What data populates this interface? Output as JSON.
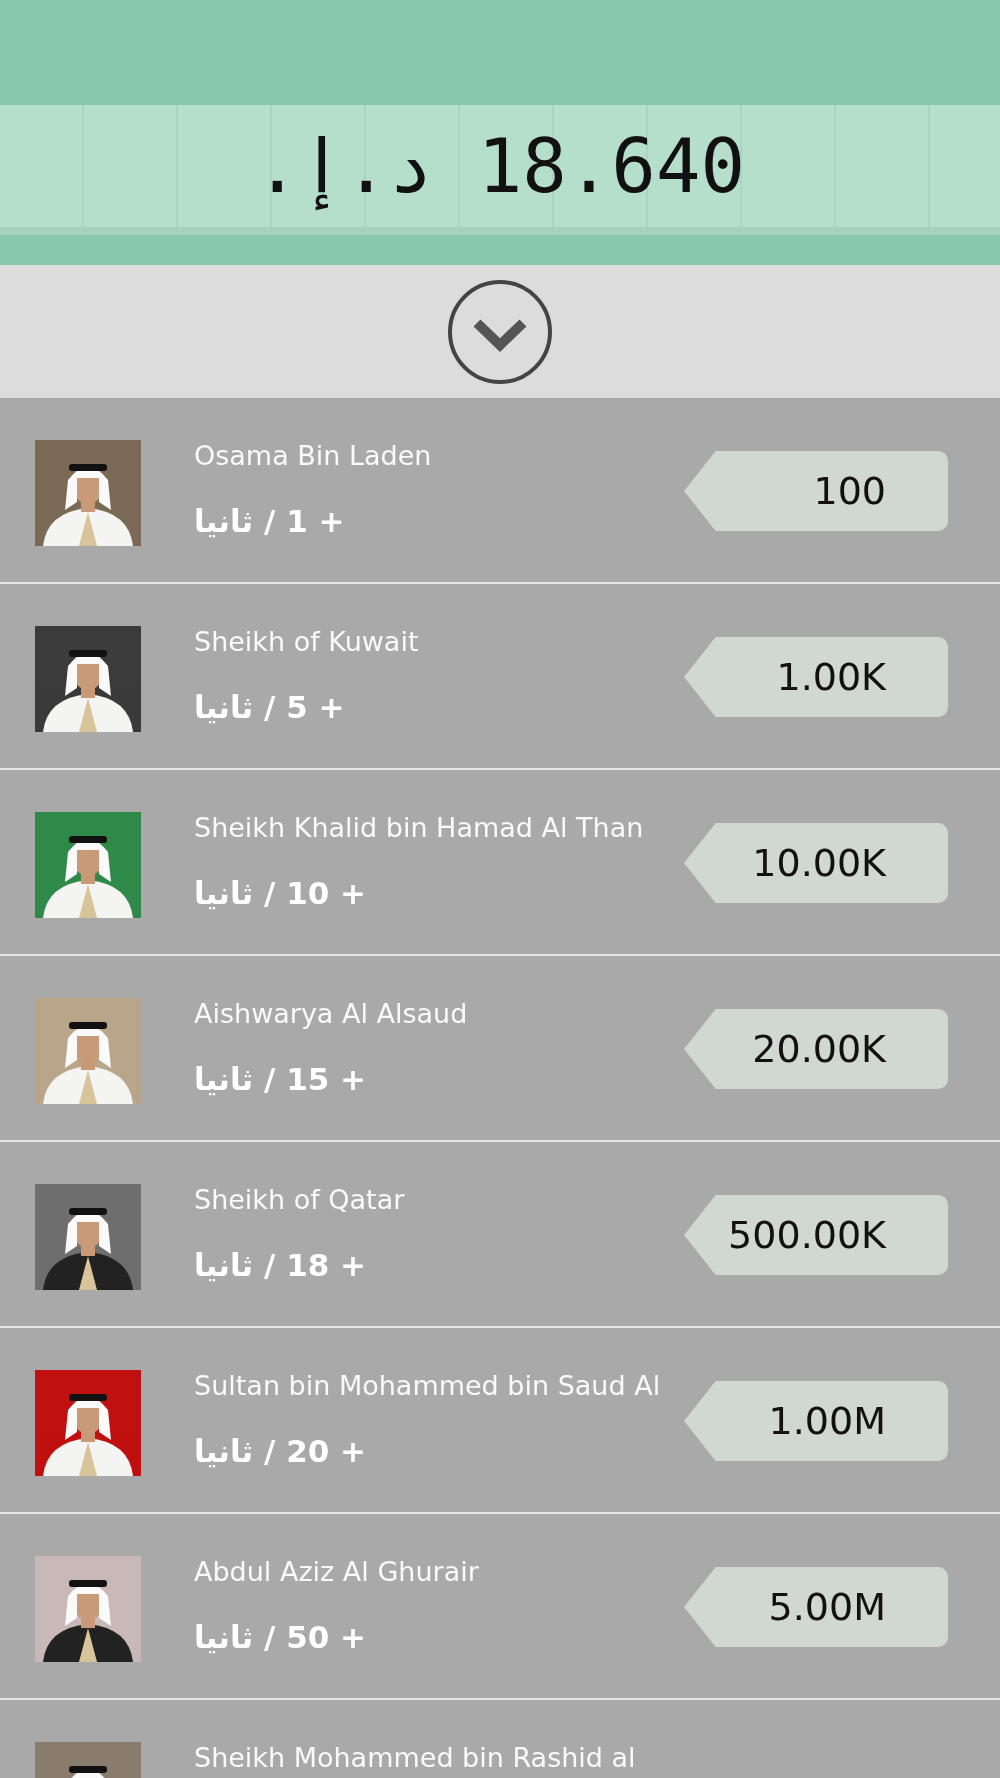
{
  "balance": "18.640 د.إ.",
  "toggle": {
    "expanded": false
  },
  "items": [
    {
      "name": "Osama Bin Laden",
      "rate": "+ 1 / ثانيا",
      "price": "100"
    },
    {
      "name": "Sheikh of Kuwait",
      "rate": "+ 5 / ثانيا",
      "price": "1.00K"
    },
    {
      "name": "Sheikh Khalid bin Hamad Al Than",
      "rate": "+ 10 / ثانيا",
      "price": "10.00K"
    },
    {
      "name": "Aishwarya Al Alsaud",
      "rate": "+ 15 / ثانيا",
      "price": "20.00K"
    },
    {
      "name": "Sheikh of Qatar",
      "rate": "+ 18 / ثانيا",
      "price": "500.00K"
    },
    {
      "name": "Sultan bin Mohammed bin Saud Al",
      "rate": "+ 20 / ثانيا",
      "price": "1.00M"
    },
    {
      "name": "Abdul Aziz Al Ghurair",
      "rate": "+ 50 / ثانيا",
      "price": "5.00M"
    },
    {
      "name": "Sheikh Mohammed bin Rashid al"
    }
  ]
}
